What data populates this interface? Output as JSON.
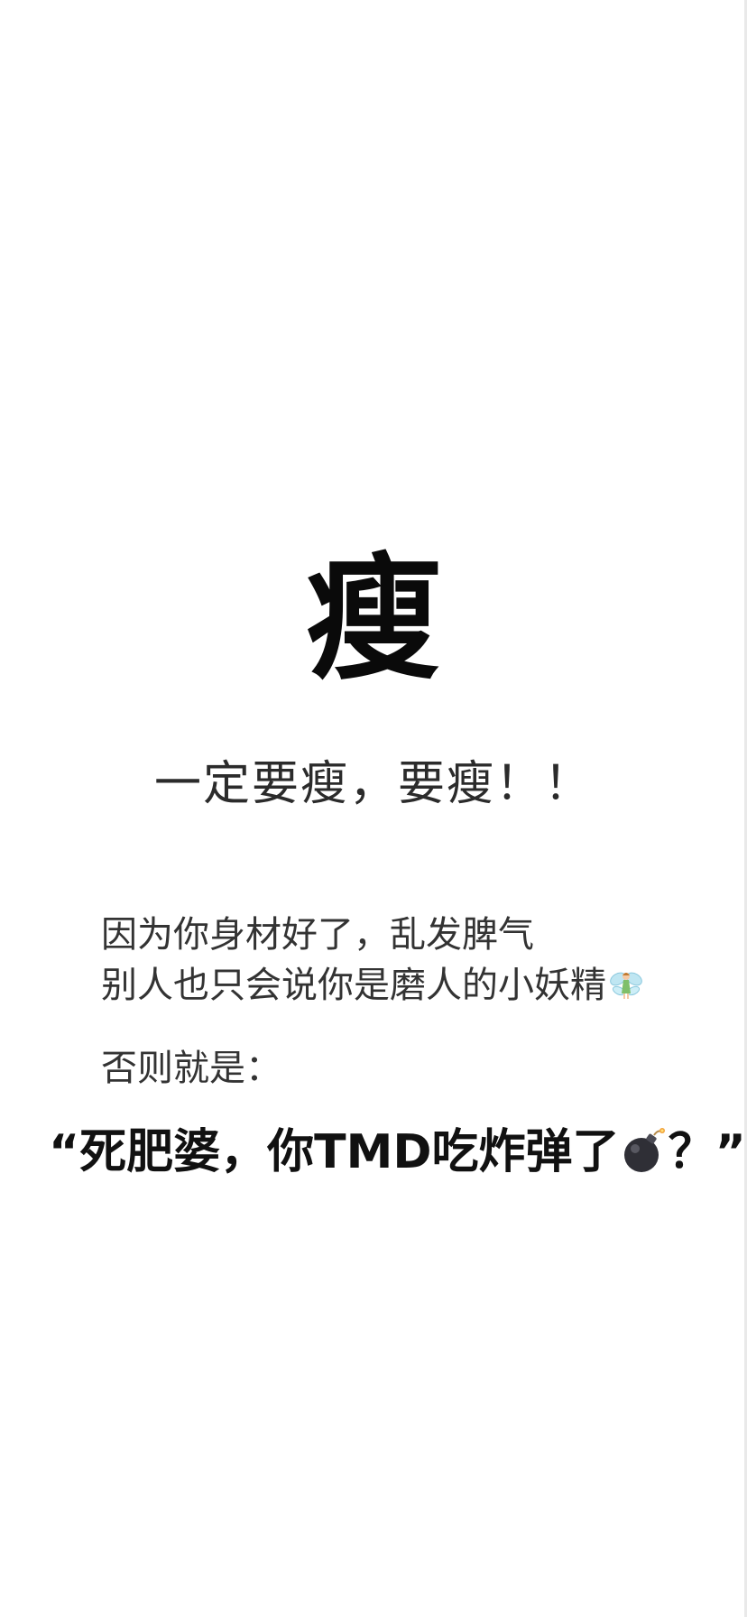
{
  "headline": "瘦",
  "subheadline": "一定要瘦，要瘦！！",
  "body": {
    "line1": "因为你身材好了，乱发脾气",
    "line2": "别人也只会说你是磨人的小妖精",
    "line3": "否则就是："
  },
  "quote": {
    "part1": "“死肥婆，你TMD吃炸弹了",
    "part2": "？”"
  },
  "icons": {
    "fairy": "fairy-icon",
    "bomb": "bomb-icon"
  }
}
